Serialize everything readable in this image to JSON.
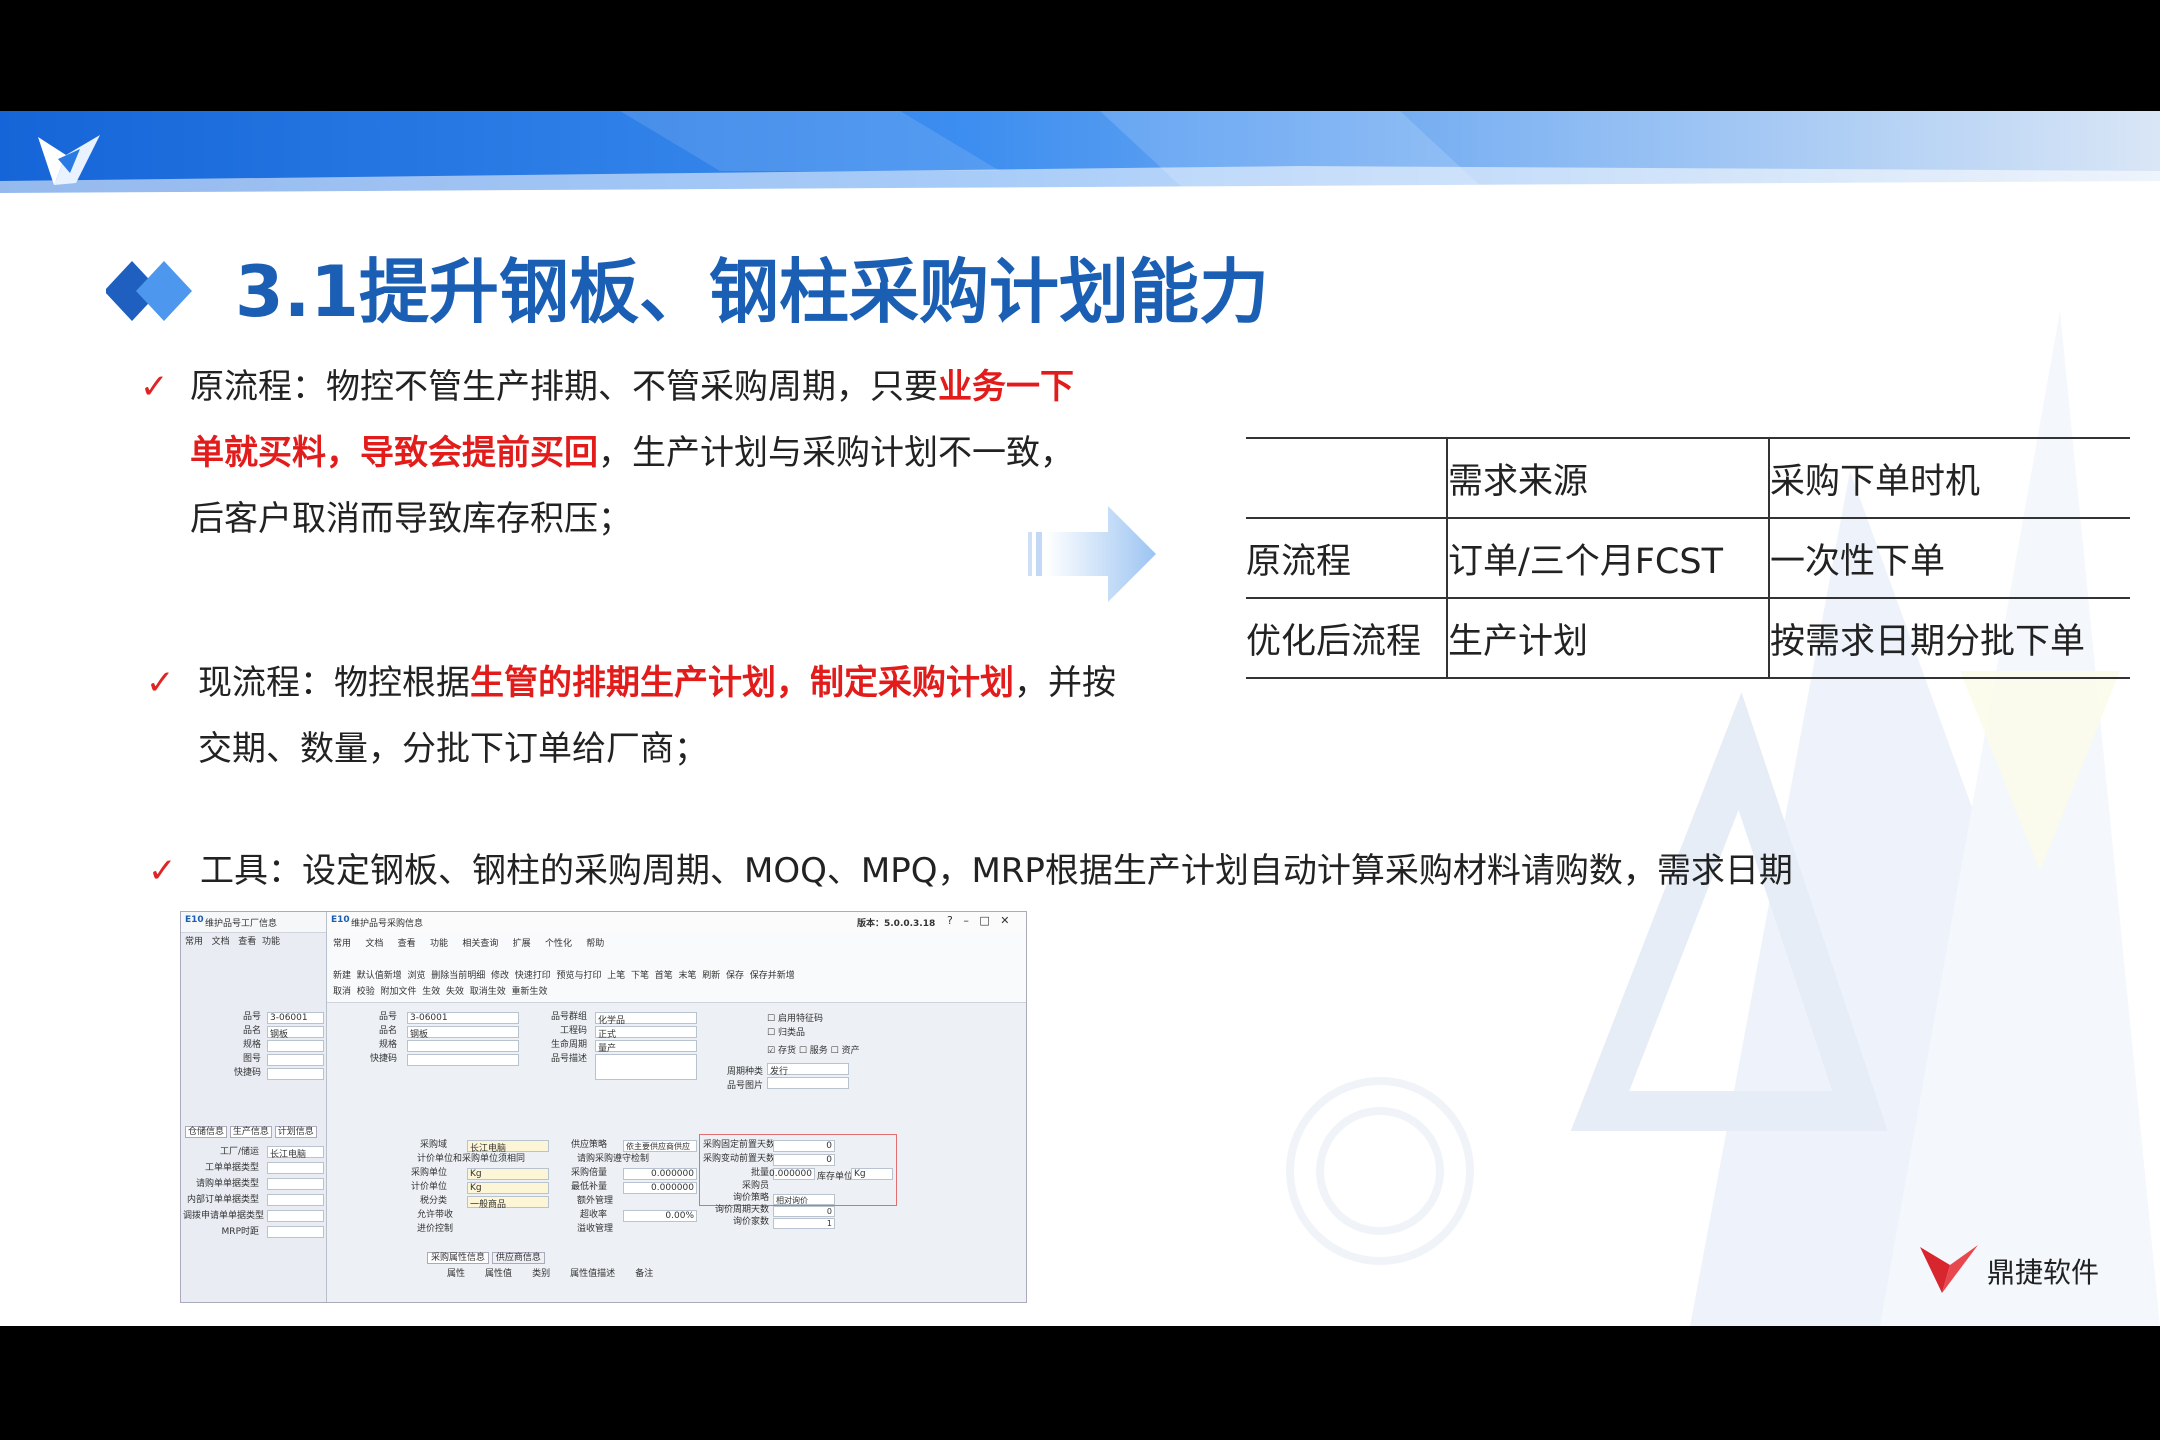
{
  "slide": {
    "title": "3.1提升钢板、钢柱采购计划能力",
    "bullets": [
      {
        "check": "✓",
        "lines": [
          [
            "原流程：物控不管生产排期、不管采购周期，只要",
            "业务一下"
          ],
          [
            "单就买料，导致会提前买回",
            "，生产计划与采购计划不一致，"
          ],
          [
            "后客户取消而导致库存积压；"
          ]
        ]
      },
      {
        "check": "✓",
        "lines": [
          [
            "现流程：物控根据",
            "生管的排期生产计划，制定采购计划",
            "，并按"
          ],
          [
            "交期、数量，分批下订单给厂商；"
          ]
        ]
      },
      {
        "check": "✓",
        "text": "工具：设定钢板、钢柱的采购周期、MOQ、MPQ，MRP根据生产计划自动计算采购材料请购数，需求日期"
      }
    ],
    "table": {
      "header": [
        "",
        "需求来源",
        "采购下单时机"
      ],
      "rows": [
        [
          "原流程",
          "订单/三个月FCST",
          "一次性下单"
        ],
        [
          "优化后流程",
          "生产计划",
          "按需求日期分批下单"
        ]
      ]
    },
    "brand": "鼎捷软件",
    "colors": {
      "title": "#1a5fb4",
      "highlight": "#e21b1b",
      "banner": "#1e6fd9"
    }
  },
  "screenshot": {
    "window1_title": "维护品号工厂信息",
    "window2_title": "维护品号采购信息",
    "version": "版本：5.0.0.3.18",
    "tabs": [
      "常用",
      "文档",
      "查看",
      "功能",
      "相关查询",
      "扩展",
      "个性化",
      "帮助"
    ],
    "tools": [
      "新建",
      "默认值新增",
      "浏览",
      "删除当前明细",
      "修改",
      "快速打印",
      "预览与打印",
      "上笔",
      "下笔",
      "首笔",
      "末笔",
      "刷新",
      "保存",
      "保存并新增",
      "取消",
      "校验",
      "附加文件",
      "生效",
      "失效",
      "取消生效",
      "重新生效"
    ],
    "left_fields": [
      "品号",
      "品名",
      "规格",
      "图号",
      "快捷码"
    ],
    "left_values": [
      "3-06001",
      "钢板",
      "",
      "",
      ""
    ],
    "mid_fields": [
      "品号",
      "品名",
      "规格",
      "快捷码"
    ],
    "mid_values": [
      "3-06001",
      "钢板",
      "",
      ""
    ],
    "right_fields": [
      "品号群组",
      "工程码",
      "生命周期",
      "品号描述"
    ],
    "right_values": [
      "化学品",
      "正式",
      "量产",
      ""
    ],
    "flags": [
      "启用特征码",
      "归类品",
      "存货",
      "服务",
      "资产"
    ],
    "period_label": "周期种类",
    "period_value": "发行",
    "pic_label": "品号图片",
    "sub_tabs": [
      "仓储信息",
      "生产信息",
      "计划信息"
    ],
    "plan_fields": [
      "工厂/储运",
      "工单单据类型",
      "请购单单据类型",
      "内部订单单据类型",
      "调拨申请单单据类型",
      "MRP时距"
    ],
    "plan_values": [
      "长江电脑",
      "",
      "",
      "",
      "",
      ""
    ],
    "purch_fields": [
      "采购域",
      "采购单位",
      "计价单位",
      "税分类"
    ],
    "purch_values": [
      "长江电脑",
      "Kg",
      "Kg",
      "一般商品"
    ],
    "purch_checks": [
      "计价单位和采购单位须相同",
      "允许带收",
      "进价控制"
    ],
    "supply_fields": [
      "供应策略",
      "采购倍量",
      "最低补量",
      "额外管理",
      "超收率",
      "溢收管理"
    ],
    "supply_values": [
      "依主要供应商供应",
      "0.000000",
      "0.000000",
      "",
      "0.00%",
      ""
    ],
    "supply_check": "请购采购遵守检制",
    "lead_fields": [
      "采购固定前置天数",
      "采购变动前置天数",
      "批量"
    ],
    "lead_values": [
      "0",
      "0",
      "0.000000"
    ],
    "stock_unit_label": "库存单位",
    "stock_unit_value": "Kg",
    "buyer_fields": [
      "采购员",
      "询价策略",
      "询价周期天数",
      "询价家数"
    ],
    "buyer_values": [
      "",
      "相对询价",
      "0",
      "1"
    ],
    "bottom_tabs": [
      "采购属性信息",
      "供应商信息"
    ],
    "bottom_cols": [
      "属性",
      "属性值",
      "类别",
      "属性值描述",
      "备注"
    ]
  }
}
